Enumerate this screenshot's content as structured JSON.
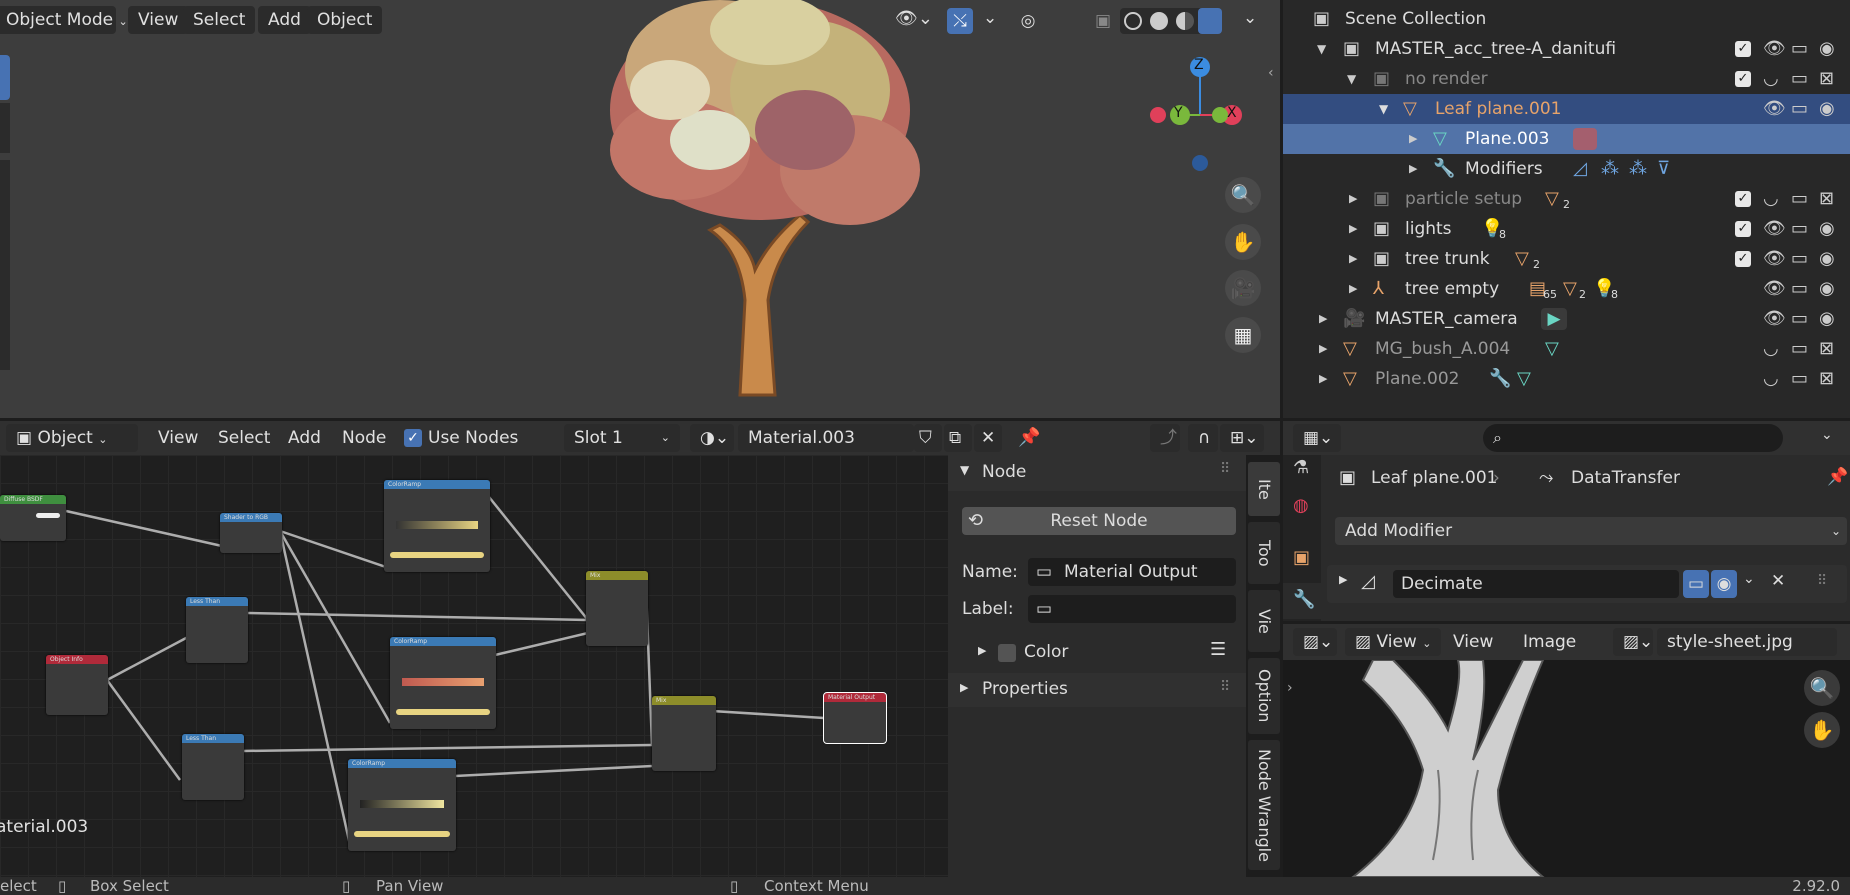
{
  "viewport": {
    "mode_label": "Object Mode",
    "menus": [
      "View",
      "Select",
      "Add",
      "Object"
    ],
    "gizmo": {
      "z": "Z",
      "y": "Y",
      "x": "X"
    }
  },
  "outliner": {
    "rows": [
      {
        "label": "Scene Collection",
        "dim": false
      },
      {
        "label": "MASTER_acc_tree-A_danitufi",
        "dim": false
      },
      {
        "label": "no render",
        "dim": true
      },
      {
        "label": "Leaf plane.001",
        "dim": false
      },
      {
        "label": "Plane.003",
        "dim": false
      },
      {
        "label": "Modifiers",
        "dim": false
      },
      {
        "label": "particle setup",
        "dim": true,
        "badge": "2"
      },
      {
        "label": "lights",
        "dim": false,
        "badge": "8"
      },
      {
        "label": "tree trunk",
        "dim": false,
        "badge": "2"
      },
      {
        "label": "tree empty",
        "dim": false,
        "badges": [
          "65",
          "2",
          "8"
        ]
      },
      {
        "label": "MASTER_camera",
        "dim": false
      },
      {
        "label": "MG_bush_A.004",
        "dim": true
      },
      {
        "label": "Plane.002",
        "dim": true
      }
    ]
  },
  "node_editor": {
    "object_label": "Object",
    "menus": [
      "View",
      "Select",
      "Add",
      "Node"
    ],
    "use_nodes_label": "Use Nodes",
    "slot_label": "Slot 1",
    "material_name": "Material.003",
    "footer_label": "aterial.003"
  },
  "node_panel": {
    "section": "Node",
    "reset_label": "Reset Node",
    "name_label": "Name:",
    "name_value": "Material Output",
    "label_label": "Label:",
    "label_value": "",
    "color_label": "Color",
    "properties_label": "Properties",
    "tabs": [
      "Ite",
      "Too",
      "Vie",
      "Option",
      "Node Wrangle"
    ]
  },
  "properties": {
    "object_name": "Leaf plane.001",
    "modifier_tab": "DataTransfer",
    "add_modifier": "Add Modifier",
    "modifier_name": "Decimate"
  },
  "image_editor": {
    "view_label": "View",
    "menus": [
      "View",
      "Image"
    ],
    "image_name": "style-sheet.jpg"
  },
  "status": {
    "left": "elect",
    "box_select": "Box Select",
    "pan_view": "Pan View",
    "context_menu": "Context Menu",
    "version": "2.92.0"
  },
  "nodes": [
    {
      "id": "diffuse",
      "title": "Diffuse BSDF",
      "color": "#3f8f3f"
    },
    {
      "id": "shader2rgb",
      "title": "Shader to RGB",
      "color": "#3b7ab5"
    },
    {
      "id": "ramp1",
      "title": "ColorRamp",
      "color": "#3b7ab5"
    },
    {
      "id": "lessthan1",
      "title": "Less Than",
      "color": "#3b7ab5"
    },
    {
      "id": "mix1",
      "title": "Mix",
      "color": "#8d8d2a"
    },
    {
      "id": "objinfo",
      "title": "Object Info",
      "color": "#b02a3a"
    },
    {
      "id": "ramp2",
      "title": "ColorRamp",
      "color": "#3b7ab5"
    },
    {
      "id": "mix2",
      "title": "Mix",
      "color": "#8d8d2a"
    },
    {
      "id": "matout",
      "title": "Material Output",
      "color": "#b02a3a"
    },
    {
      "id": "lessthan2",
      "title": "Less Than",
      "color": "#3b7ab5"
    },
    {
      "id": "ramp3",
      "title": "ColorRamp",
      "color": "#3b7ab5"
    }
  ]
}
